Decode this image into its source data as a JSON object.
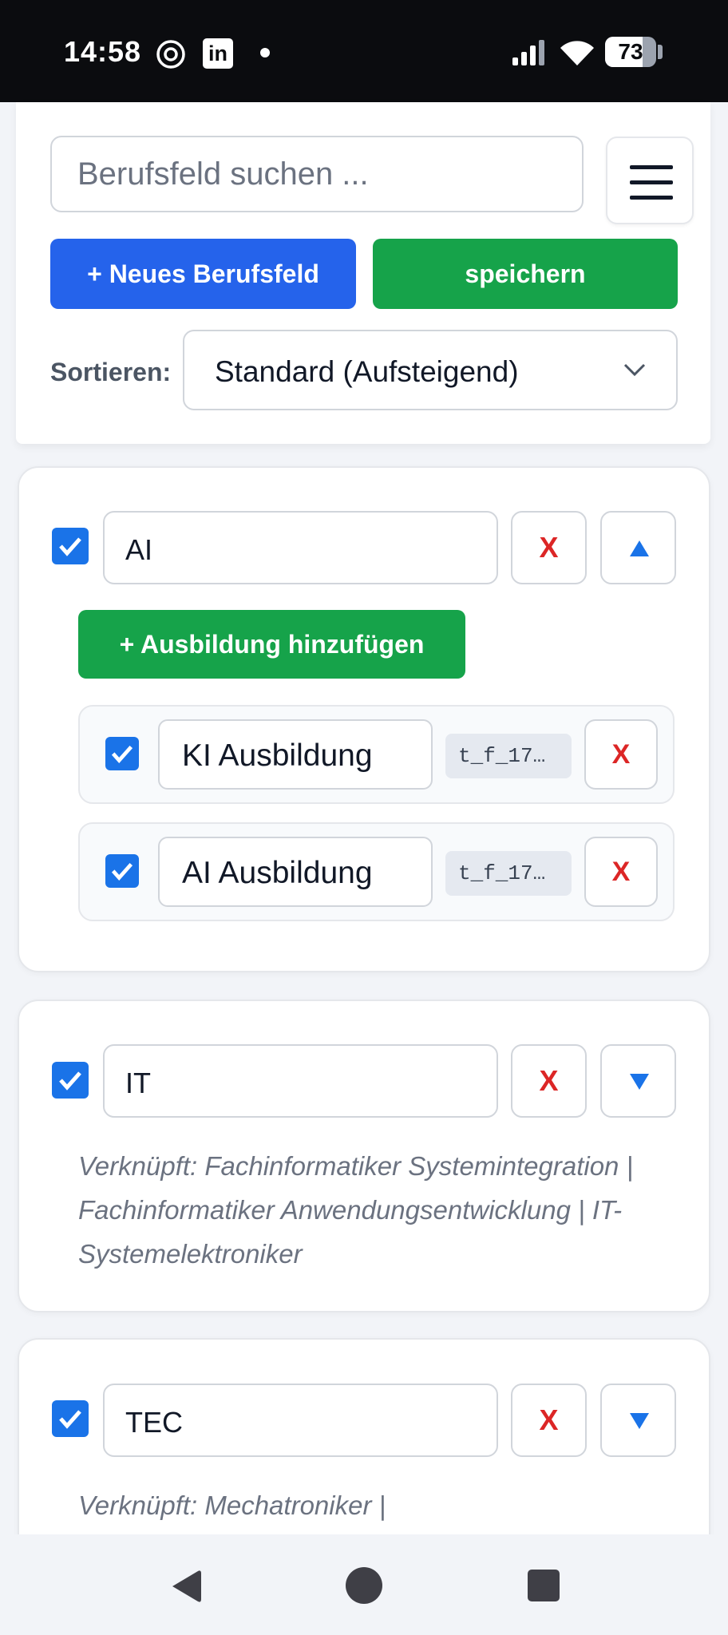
{
  "status_bar": {
    "time": "14:58",
    "battery": "73",
    "icons": [
      "threads-icon",
      "linkedin-icon",
      "notification-dot-icon",
      "signal-icon",
      "wifi-icon",
      "battery-icon"
    ]
  },
  "header": {
    "search_placeholder": "Berufsfeld suchen ...",
    "new_button": "+ Neues Berufsfeld",
    "save_button": "speichern",
    "sort_label": "Sortieren:",
    "sort_value": "Standard (Aufsteigend)"
  },
  "colors": {
    "primary": "#2563eb",
    "success": "#16a34a",
    "danger": "#dc2626",
    "checkbox": "#1a73e8"
  },
  "cards": [
    {
      "name": "AI",
      "delete_label": "X",
      "expanded": true,
      "add_button": "+ Ausbildung hinzufügen",
      "items": [
        {
          "name": "KI Ausbildung",
          "id": "t_f_17…",
          "delete_label": "X"
        },
        {
          "name": "AI Ausbildung",
          "id": "t_f_17…",
          "delete_label": "X"
        }
      ]
    },
    {
      "name": "IT",
      "delete_label": "X",
      "expanded": false,
      "linked": "Verknüpft: Fachinformatiker Systemintegration | Fachinformatiker Anwendungsentwicklung | IT-Systemelektroniker"
    },
    {
      "name": "TEC",
      "delete_label": "X",
      "expanded": false,
      "linked": "Verknüpft: Mechatroniker |"
    }
  ]
}
